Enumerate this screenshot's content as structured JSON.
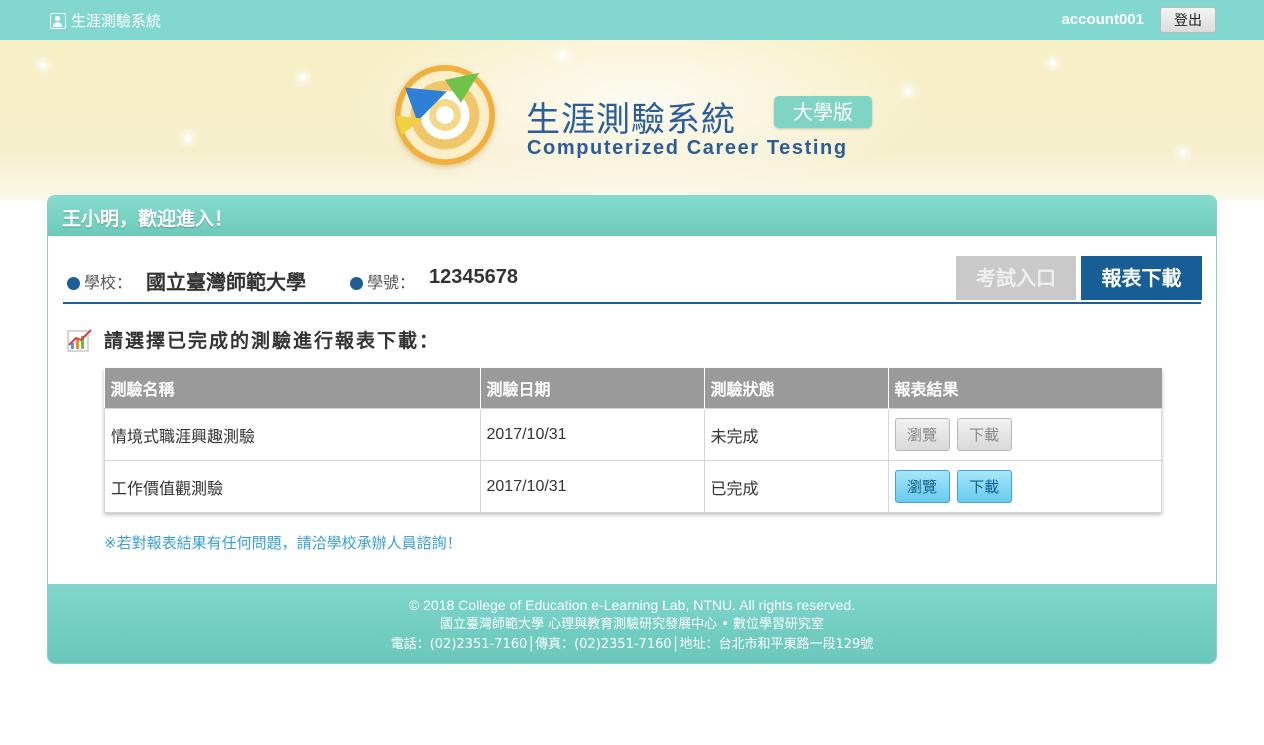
{
  "topbar": {
    "app_title": "生涯測驗系統",
    "account": "account001",
    "logout_label": "登出"
  },
  "hero": {
    "title_cn": "生涯測驗系統",
    "edition": "大學版",
    "title_en": "Computerized Career Testing"
  },
  "panel": {
    "welcome": "王小明，歡迎進入！",
    "school_label": "學校：",
    "school_value": "國立臺灣師範大學",
    "student_id_label": "學號：",
    "student_id_value": "12345678",
    "exam_entry_label": "考試入口",
    "report_download_label": "報表下載",
    "instruction": "請選擇已完成的測驗進行報表下載："
  },
  "table": {
    "headers": [
      "測驗名稱",
      "測驗日期",
      "測驗狀態",
      "報表結果"
    ],
    "rows": [
      {
        "name": "情境式職涯興趣測驗",
        "date": "2017/10/31",
        "status": "未完成",
        "view": "瀏覽",
        "download": "下載"
      },
      {
        "name": "工作價值觀測驗",
        "date": "2017/10/31",
        "status": "已完成",
        "view": "瀏覽",
        "download": "下載"
      }
    ]
  },
  "note": "※若對報表結果有任何問題，請洽學校承辦人員諮詢！",
  "footer": {
    "line1": "© 2018 College of Education e-Learning Lab, NTNU. All rights reserved.",
    "line2": "國立臺灣師範大學 心理與教育測驗研究發展中心 • 數位學習研究室",
    "line3": "電話：(02)2351-7160│傳真：(02)2351-7160│地址：台北市和平東路一段129號"
  },
  "colors": {
    "topbar": "#82d8d0",
    "primary_blue": "#175e97",
    "link_blue": "#3a9fd8",
    "table_header": "#9a9a9a"
  }
}
